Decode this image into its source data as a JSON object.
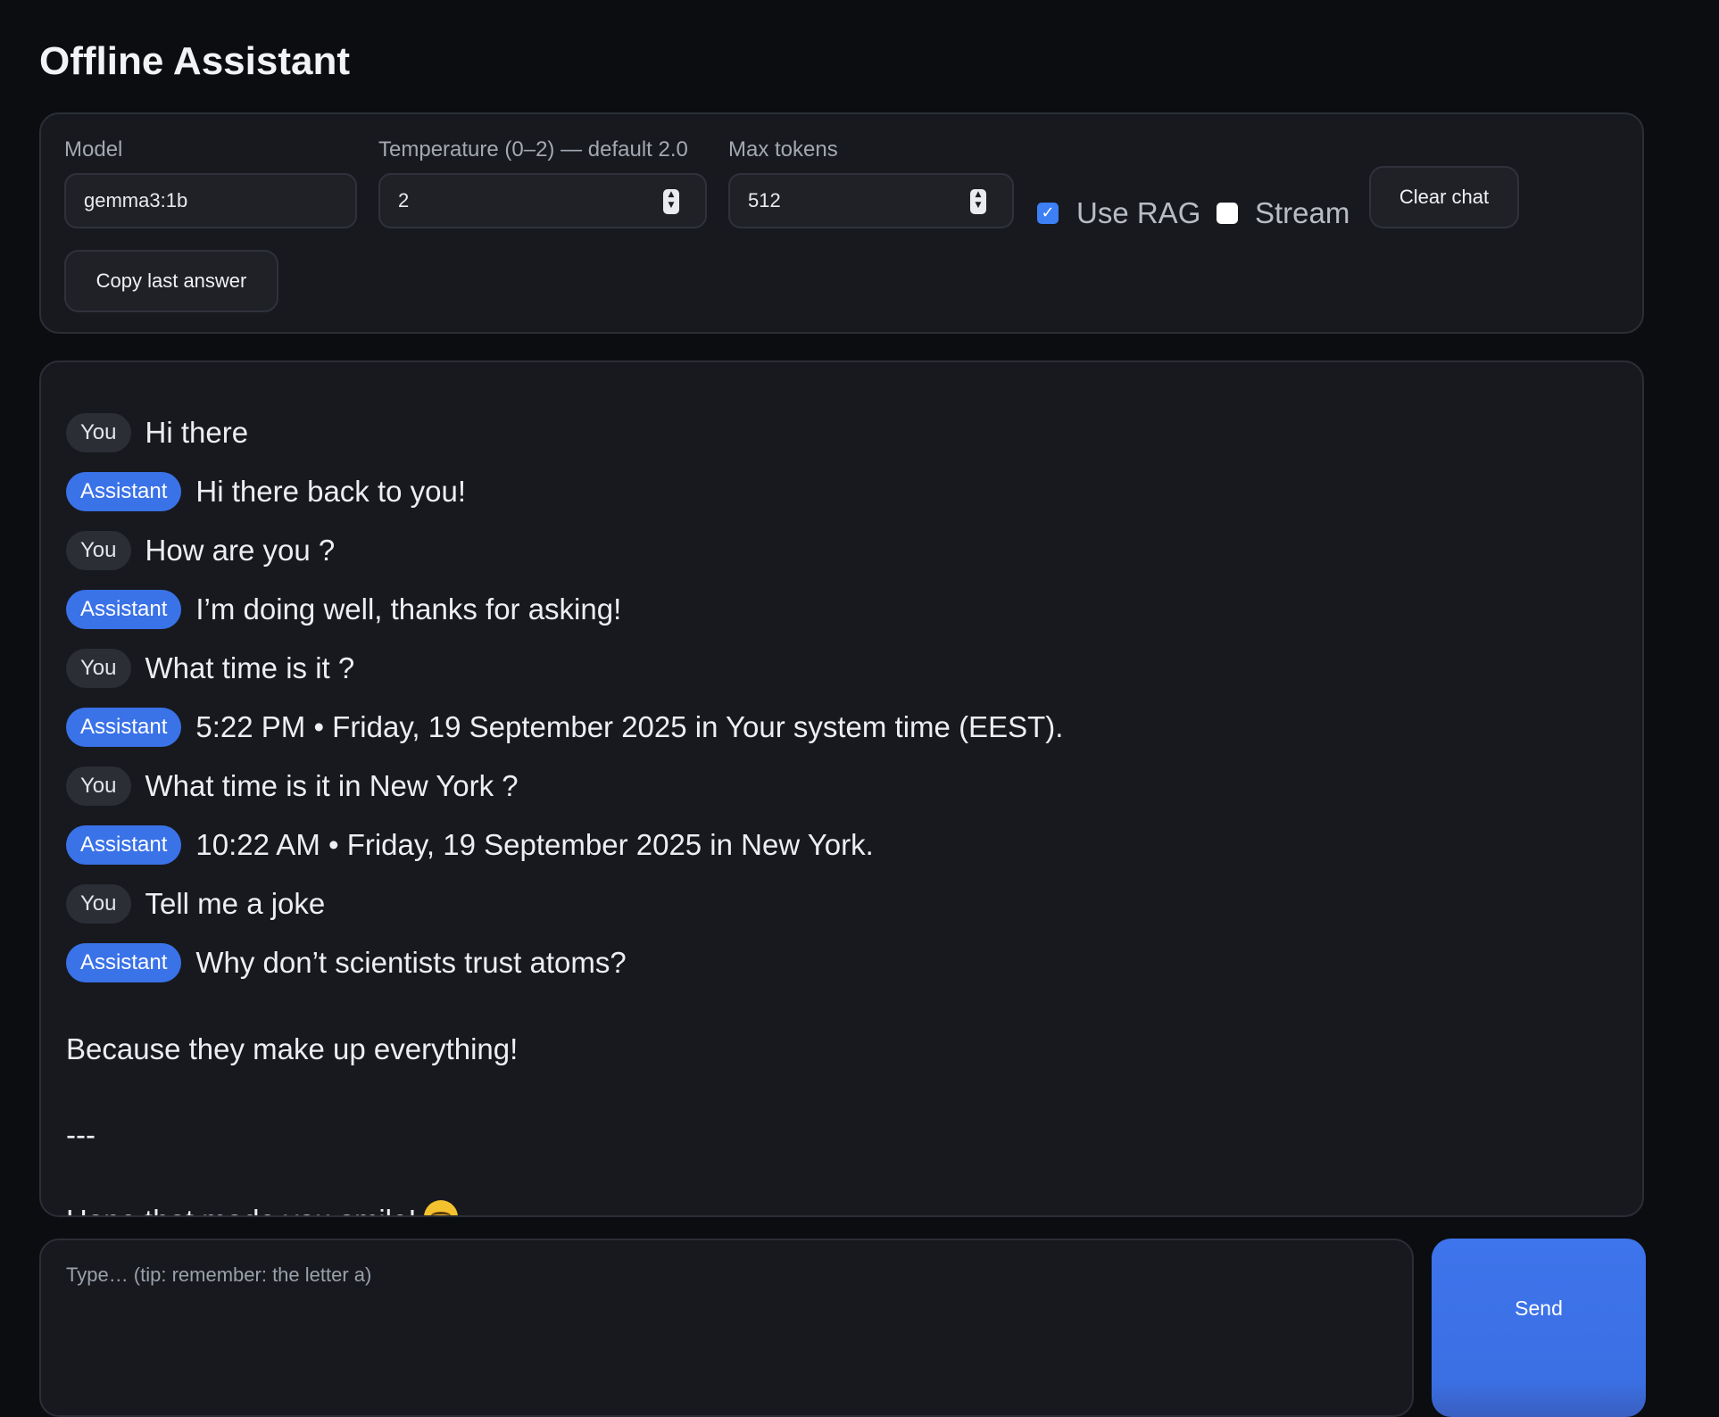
{
  "app": {
    "title": "Offline Assistant"
  },
  "settings": {
    "model_label": "Model",
    "model_value": "gemma3:1b",
    "temperature_label": "Temperature (0–2) — default 2.0",
    "temperature_value": "2",
    "max_tokens_label": "Max tokens",
    "max_tokens_value": "512",
    "use_rag_label": "Use RAG",
    "use_rag_checked": true,
    "stream_label": "Stream",
    "stream_checked": false,
    "clear_chat_label": "Clear chat",
    "copy_last_label": "Copy last answer"
  },
  "chat": {
    "messages": [
      {
        "role": "You",
        "text": "Hi there"
      },
      {
        "role": "Assistant",
        "text": "Hi there back to you!"
      },
      {
        "role": "You",
        "text": "How are you ?"
      },
      {
        "role": "Assistant",
        "text": "I’m doing well, thanks for asking!"
      },
      {
        "role": "You",
        "text": "What time is it ?"
      },
      {
        "role": "Assistant",
        "text": "5:22 PM • Friday, 19 September 2025 in Your system time (EEST)."
      },
      {
        "role": "You",
        "text": "What time is it in New York ?"
      },
      {
        "role": "Assistant",
        "text": "10:22 AM • Friday, 19 September 2025 in New York."
      },
      {
        "role": "You",
        "text": "Tell me a joke"
      },
      {
        "role": "Assistant",
        "text": "Why don’t scientists trust atoms?"
      }
    ],
    "continuation": [
      "Because they make up everything!",
      "---",
      "Hope that made you smile!"
    ]
  },
  "composer": {
    "placeholder": "Type… (tip: remember: the letter a)",
    "value": "",
    "send_label": "Send"
  },
  "colors": {
    "accent": "#3a72e8",
    "background": "#0b0d11",
    "panel": "#17191e"
  }
}
